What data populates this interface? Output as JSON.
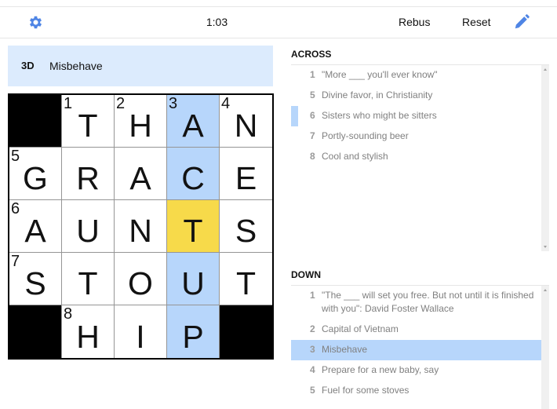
{
  "toolbar": {
    "settings_icon": "gear-icon",
    "timer": "1:03",
    "rebus_label": "Rebus",
    "reset_label": "Reset",
    "pencil_icon": "pencil-icon",
    "accent_color": "#4f85e5"
  },
  "current_clue": {
    "label": "3D",
    "text": "Misbehave"
  },
  "grid": {
    "rows": [
      [
        {
          "block": true
        },
        {
          "num": "1",
          "letter": "T"
        },
        {
          "num": "2",
          "letter": "H"
        },
        {
          "num": "3",
          "letter": "A",
          "state": "word"
        },
        {
          "num": "4",
          "letter": "N"
        }
      ],
      [
        {
          "num": "5",
          "letter": "G"
        },
        {
          "letter": "R"
        },
        {
          "letter": "A"
        },
        {
          "letter": "C",
          "state": "word"
        },
        {
          "letter": "E"
        }
      ],
      [
        {
          "num": "6",
          "letter": "A"
        },
        {
          "letter": "U"
        },
        {
          "letter": "N"
        },
        {
          "letter": "T",
          "state": "current"
        },
        {
          "letter": "S"
        }
      ],
      [
        {
          "num": "7",
          "letter": "S"
        },
        {
          "letter": "T"
        },
        {
          "letter": "O"
        },
        {
          "letter": "U",
          "state": "word"
        },
        {
          "letter": "T"
        }
      ],
      [
        {
          "block": true
        },
        {
          "num": "8",
          "letter": "H"
        },
        {
          "letter": "I"
        },
        {
          "letter": "P",
          "state": "word"
        },
        {
          "block": true
        }
      ]
    ]
  },
  "across": {
    "title": "ACROSS",
    "clues": [
      {
        "num": "1",
        "text": "\"More ___ you'll ever know\""
      },
      {
        "num": "5",
        "text": "Divine favor, in Christianity"
      },
      {
        "num": "6",
        "text": "Sisters who might be sitters",
        "cross": true
      },
      {
        "num": "7",
        "text": "Portly-sounding beer"
      },
      {
        "num": "8",
        "text": "Cool and stylish"
      }
    ]
  },
  "down": {
    "title": "DOWN",
    "clues": [
      {
        "num": "1",
        "text": "\"The ___ will set you free. But not until it is finished with you\": David Foster Wallace"
      },
      {
        "num": "2",
        "text": "Capital of Vietnam"
      },
      {
        "num": "3",
        "text": "Misbehave",
        "highlight": true
      },
      {
        "num": "4",
        "text": "Prepare for a new baby, say"
      },
      {
        "num": "5",
        "text": "Fuel for some stoves"
      }
    ]
  }
}
